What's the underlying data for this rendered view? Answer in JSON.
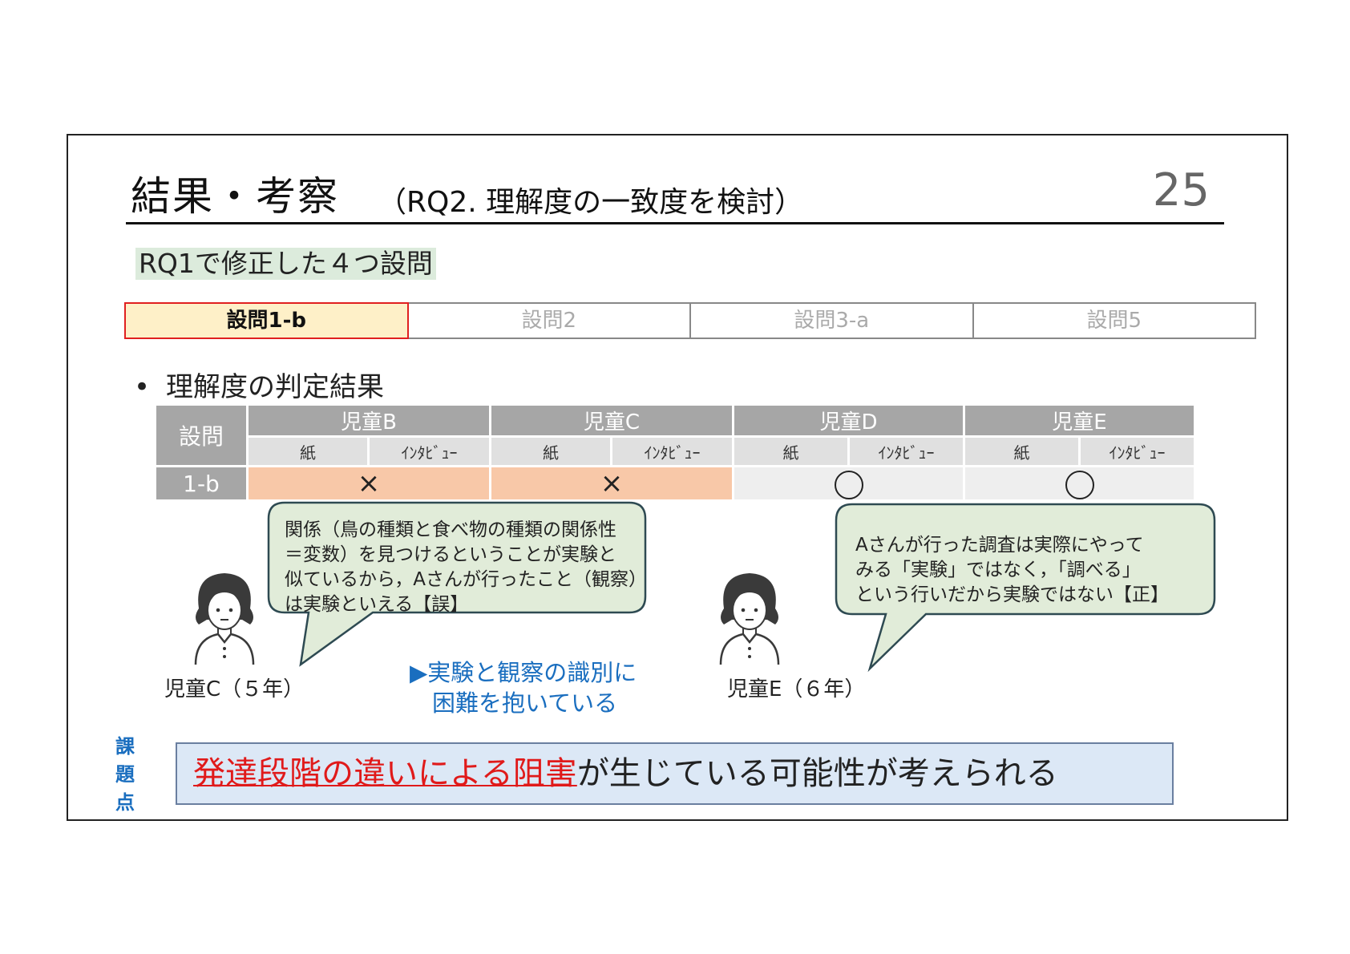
{
  "slide": {
    "title": "結果・考察",
    "subtitle": "（RQ2. 理解度の一致度を検討）",
    "page_number": "25",
    "rq_label": "RQ1で修正した４つ設問"
  },
  "question_tabs": [
    {
      "label": "設問1-b",
      "active": true
    },
    {
      "label": "設問2",
      "active": false
    },
    {
      "label": "設問3-a",
      "active": false
    },
    {
      "label": "設問5",
      "active": false
    }
  ],
  "bullet": {
    "dot": "•",
    "text": "理解度の判定結果"
  },
  "results_table": {
    "header_question": "設問",
    "children": [
      "児童B",
      "児童C",
      "児童D",
      "児童E"
    ],
    "subheaders": [
      "紙",
      "ｲﾝﾀﾋﾞｭｰ"
    ],
    "row_label": "1-b",
    "row_values": [
      "×",
      "×",
      "○",
      "○"
    ]
  },
  "bubble_left": {
    "lines": [
      "関係（鳥の種類と食べ物の種類の関係性",
      "＝変数）を見つけるということが実験と",
      "似ているから，Aさんが行ったこと（観察）",
      "は実験といえる【誤】"
    ]
  },
  "bubble_right": {
    "lines": [
      "Aさんが行った調査は実際にやって",
      "みる「実験」ではなく，「調べる」",
      "という行いだから実験ではない【正】"
    ]
  },
  "captions": {
    "left_child": "児童C（５年）",
    "right_child": "児童E（６年）"
  },
  "note": {
    "line1": "▶実験と観察の識別に",
    "line2": "困難を抱いている"
  },
  "issue_tag": [
    "課",
    "題",
    "点"
  ],
  "conclusion": {
    "highlight": "発達段階の違いによる阻害",
    "rest": "が生じている可能性が考えられる"
  }
}
